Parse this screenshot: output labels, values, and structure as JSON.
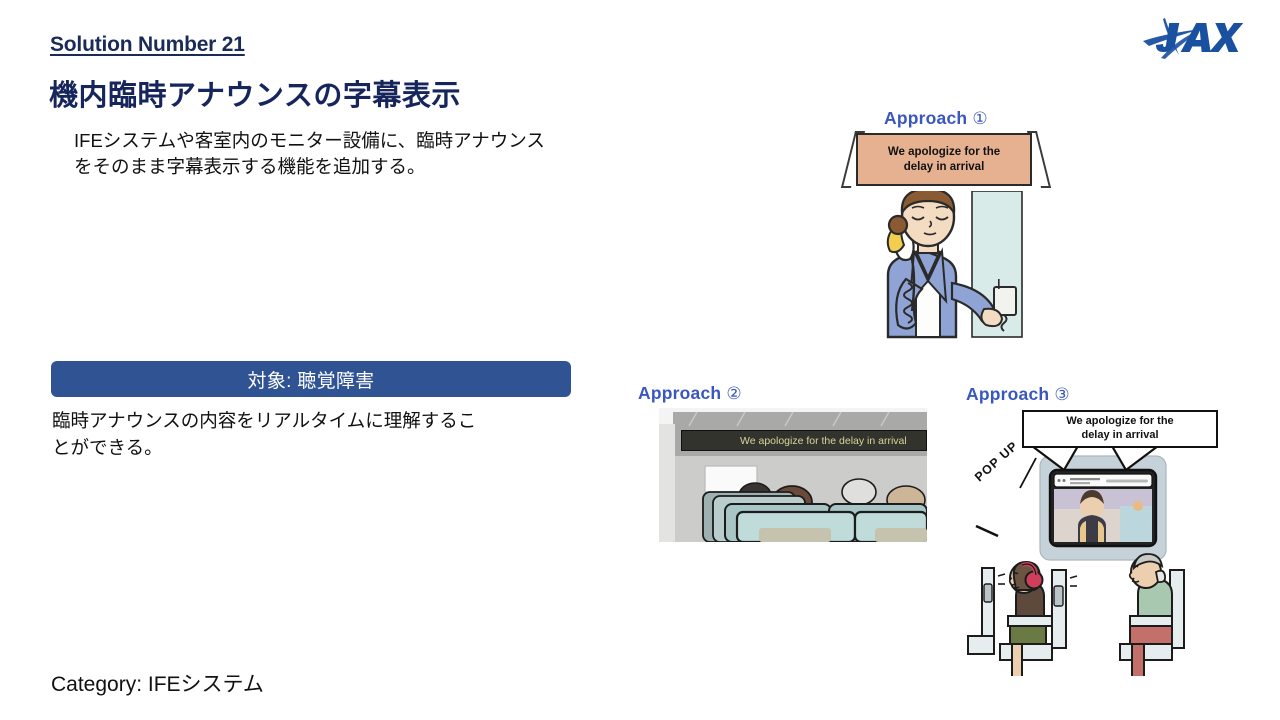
{
  "slide": {
    "solution_number": "Solution Number 21",
    "title": "機内臨時アナウンスの字幕表示",
    "summary": "IFEシステムや客室内のモニター設備に、臨時アナウンス\nをそのまま字幕表示する機能を追加する。",
    "target_banner_label": "対象: 聴覚障害",
    "benefit": "臨時アナウンスの内容をリアルタイムに理解するこ\nとができる。",
    "category": "Category: IFEシステム"
  },
  "logo": {
    "name": "JAXA",
    "color": "#1a50a0"
  },
  "approaches": [
    {
      "id": "approach-1",
      "label": "Approach",
      "number": "①",
      "caption": "We apologize for the\ndelay in arrival",
      "scene": "cabin-crew-announcement",
      "monitor_bg": "#e6b191"
    },
    {
      "id": "approach-2",
      "label": "Approach",
      "number": "②",
      "caption": "We apologize for the delay in arrival",
      "scene": "overhead-led-ticker-cabin",
      "ticker_bg": "#33332e",
      "ticker_text_color": "#d7d59a"
    },
    {
      "id": "approach-3",
      "label": "Approach",
      "number": "③",
      "caption": "We apologize for the\ndelay in arrival",
      "popup_label": "POP UP",
      "scene": "ife-seatback-screen-popup"
    }
  ],
  "colors": {
    "title_navy": "#16265c",
    "banner_blue": "#305394",
    "approach_blue": "#3a57c0",
    "body_text": "#111111"
  }
}
